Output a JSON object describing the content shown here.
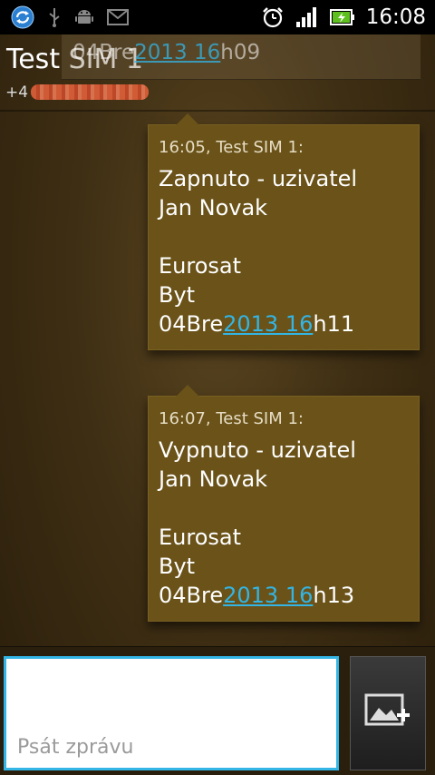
{
  "status_bar": {
    "time": "16:08",
    "icons": [
      "sync-icon",
      "usb-icon",
      "android-debug-icon",
      "mail-icon",
      "alarm-icon",
      "signal-icon",
      "battery-charging-icon"
    ]
  },
  "header": {
    "contact_name": "Test SIM 1",
    "contact_number_prefix": "+4"
  },
  "previous_message": {
    "prefix": "04Bre",
    "link": "2013 16",
    "suffix": "h09"
  },
  "messages": [
    {
      "meta": "16:05, Test SIM 1:",
      "lines": [
        "Zapnuto - uzivatel",
        "Jan Novak",
        "",
        "Eurosat",
        "Byt"
      ],
      "last_prefix": "04Bre",
      "last_link": "2013 16",
      "last_suffix": "h11"
    },
    {
      "meta": "16:07, Test SIM 1:",
      "lines": [
        "Vypnuto - uzivatel",
        "Jan Novak",
        "",
        "Eurosat",
        "Byt"
      ],
      "last_prefix": "04Bre",
      "last_link": "2013 16",
      "last_suffix": "h13"
    }
  ],
  "compose": {
    "placeholder": "Psát zprávu",
    "attach_icon": "attach-image-icon"
  },
  "colors": {
    "accent": "#33b5e5",
    "bubble": "#6a5218"
  }
}
